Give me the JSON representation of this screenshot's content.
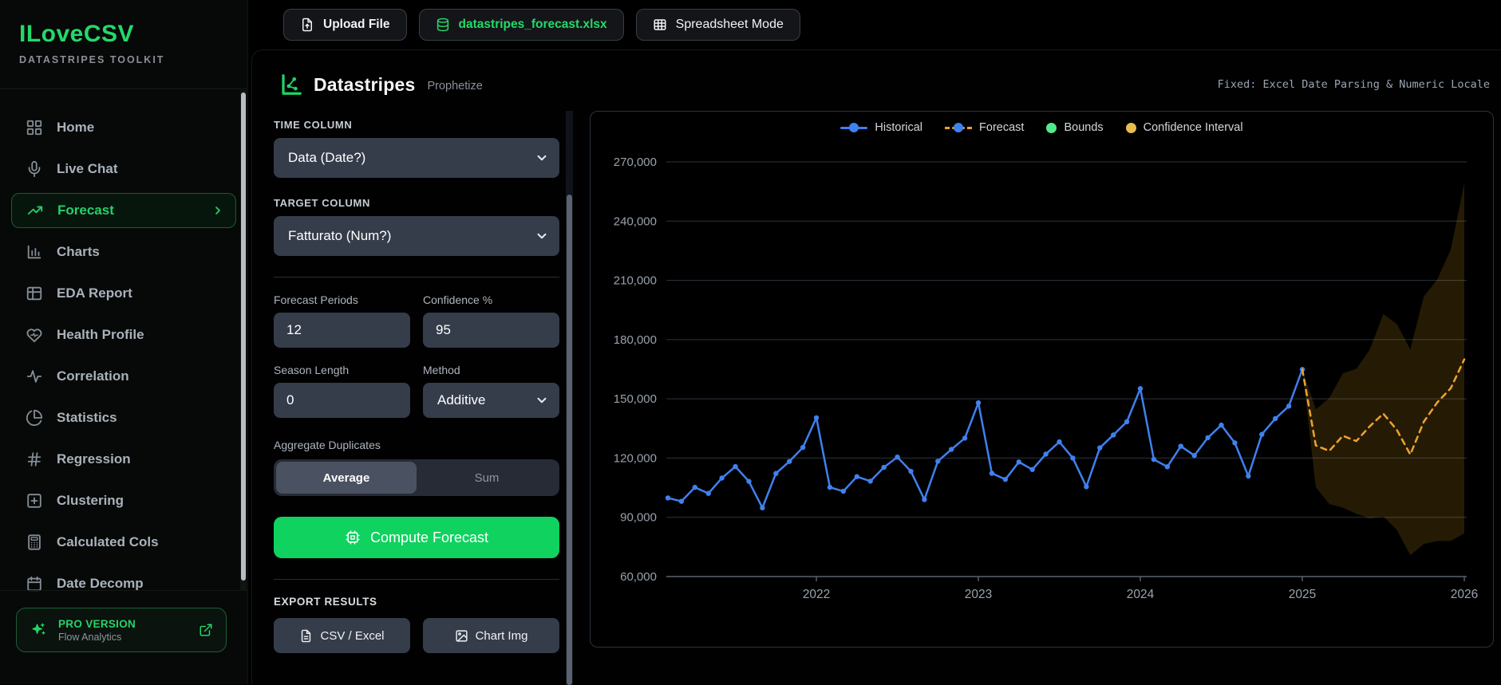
{
  "sidebar": {
    "logo_title": "ILoveCSV",
    "logo_subtitle": "DATASTRIPES TOOLKIT",
    "items": [
      {
        "label": "Home",
        "icon": "grid-icon",
        "active": false
      },
      {
        "label": "Live Chat",
        "icon": "mic-icon",
        "active": false
      },
      {
        "label": "Forecast",
        "icon": "trend-up-icon",
        "active": true
      },
      {
        "label": "Charts",
        "icon": "bar-chart-icon",
        "active": false
      },
      {
        "label": "EDA Report",
        "icon": "table-icon",
        "active": false
      },
      {
        "label": "Health Profile",
        "icon": "heart-pulse-icon",
        "active": false
      },
      {
        "label": "Correlation",
        "icon": "activity-icon",
        "active": false
      },
      {
        "label": "Statistics",
        "icon": "pie-chart-icon",
        "active": false
      },
      {
        "label": "Regression",
        "icon": "hash-icon",
        "active": false
      },
      {
        "label": "Clustering",
        "icon": "plus-square-icon",
        "active": false
      },
      {
        "label": "Calculated Cols",
        "icon": "calculator-icon",
        "active": false
      },
      {
        "label": "Date Decomp",
        "icon": "calendar-icon",
        "active": false
      }
    ],
    "pro": {
      "title": "PRO VERSION",
      "subtitle": "Flow Analytics"
    }
  },
  "toolbar": {
    "upload_label": "Upload File",
    "filename": "datastripes_forecast.xlsx",
    "spreadsheet_label": "Spreadsheet Mode"
  },
  "header": {
    "title": "Datastripes",
    "subtitle": "Prophetize",
    "status": "Fixed: Excel Date Parsing & Numeric Locale"
  },
  "config": {
    "time_column_label": "TIME COLUMN",
    "time_column_value": "Data (Date?)",
    "target_column_label": "TARGET COLUMN",
    "target_column_value": "Fatturato (Num?)",
    "forecast_periods_label": "Forecast Periods",
    "forecast_periods_value": "12",
    "confidence_label": "Confidence %",
    "confidence_value": "95",
    "season_length_label": "Season Length",
    "season_length_value": "0",
    "method_label": "Method",
    "method_value": "Additive",
    "aggregate_label": "Aggregate Duplicates",
    "aggregate_options": [
      "Average",
      "Sum"
    ],
    "aggregate_selected": "Average",
    "compute_label": "Compute Forecast"
  },
  "export": {
    "section_label": "EXPORT RESULTS",
    "csv_label": "CSV / Excel",
    "img_label": "Chart Img"
  },
  "chart_data": {
    "type": "line",
    "x_start": "2021-02",
    "x_frequency": "monthly",
    "x_tick_labels": [
      "2022",
      "2023",
      "2024",
      "2025",
      "2026"
    ],
    "x_tick_indices": [
      11,
      23,
      35,
      47,
      59
    ],
    "ylim": [
      60000,
      270000
    ],
    "y_ticks": [
      60000,
      90000,
      120000,
      150000,
      180000,
      210000,
      240000,
      270000
    ],
    "grid": true,
    "legend_position": "top",
    "legend": [
      {
        "label": "Historical",
        "swatch": "line-dot",
        "line_color": "#4080ef",
        "dot_color": "#4080ef"
      },
      {
        "label": "Forecast",
        "swatch": "dashed-dot",
        "line_color": "#f0a32f",
        "dot_color": "#4080ef"
      },
      {
        "label": "Bounds",
        "swatch": "dot",
        "dot_color": "#53e88b"
      },
      {
        "label": "Confidence Interval",
        "swatch": "dot",
        "dot_color": "#e7bd4e"
      }
    ],
    "series": [
      {
        "name": "Historical",
        "kind": "line",
        "color": "#4080ef",
        "markers": true,
        "start_index": 0,
        "values": [
          99800,
          98100,
          105200,
          102100,
          109900,
          115700,
          108200,
          94800,
          112200,
          118300,
          125400,
          140400,
          105200,
          103200,
          110600,
          108300,
          115300,
          120500,
          113300,
          99000,
          118400,
          124400,
          130100,
          148000,
          112300,
          109200,
          118000,
          114200,
          122000,
          128200,
          120000,
          105500,
          125200,
          131700,
          138400,
          155200,
          119300,
          115600,
          126000,
          121300,
          130300,
          136700,
          127700,
          110900,
          132000,
          140000,
          146300,
          164900
        ]
      },
      {
        "name": "Forecast",
        "kind": "line",
        "color": "#f0a32f",
        "dashed": true,
        "markers": false,
        "start_index": 47,
        "values": [
          164900,
          126400,
          123600,
          131300,
          128600,
          136100,
          142500,
          134300,
          121800,
          138400,
          148200,
          155400,
          170000
        ]
      },
      {
        "name": "Confidence Interval",
        "kind": "band",
        "fill": "#e8a81f",
        "opacity": 0.16,
        "start_index": 47,
        "upper": [
          164900,
          144600,
          150400,
          162900,
          165200,
          175000,
          192900,
          187900,
          175000,
          201800,
          210500,
          225700,
          259100
        ],
        "lower": [
          164900,
          105300,
          96700,
          94900,
          91800,
          89500,
          90500,
          83700,
          70800,
          76500,
          78000,
          78000,
          81900
        ]
      }
    ]
  }
}
